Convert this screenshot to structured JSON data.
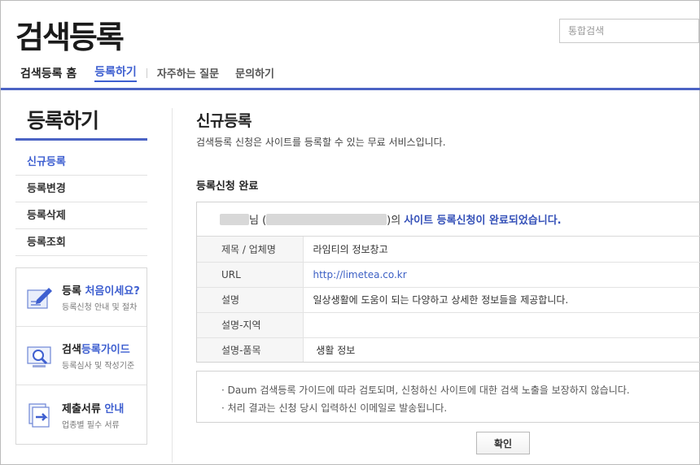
{
  "header": {
    "logo": "검색등록",
    "search_placeholder": "통합검색"
  },
  "nav": {
    "home": "검색등록 홈",
    "active": "등록하기",
    "faq": "자주하는 질문",
    "contact": "문의하기"
  },
  "sidebar": {
    "title": "등록하기",
    "items": [
      {
        "label": "신규등록"
      },
      {
        "label": "등록변경"
      },
      {
        "label": "등록삭제"
      },
      {
        "label": "등록조회"
      }
    ],
    "guides": [
      {
        "title_a": "등록 ",
        "title_b": "처음이세요?",
        "sub": "등록신청 안내 및 절차",
        "icon": "pencil-note-icon"
      },
      {
        "title_a": "검색",
        "title_b": "등록가이드",
        "sub": "등록심사 및 작성기준",
        "icon": "magnifier-screen-icon"
      },
      {
        "title_a": "제출서류 ",
        "title_b": "안내",
        "sub": "업종별 필수 서류",
        "icon": "documents-arrow-icon"
      }
    ]
  },
  "main": {
    "title": "신규등록",
    "description": "검색등록 신청은 사이트를 등록할 수 있는 무료 서비스입니다.",
    "section_title": "등록신청 완료",
    "result": {
      "suffix_nim": "님 (",
      "suffix_close": ")의",
      "complete_msg": "사이트 등록신청이 완료되었습니다.",
      "rows": [
        {
          "label": "제목 / 업체명",
          "value": "라임티의 정보창고"
        },
        {
          "label": "URL",
          "value": "http://limetea.co.kr"
        },
        {
          "label": "설명",
          "value": "일상생활에 도움이 되는 다양하고 상세한 정보들을 제공합니다."
        },
        {
          "label": "설명-지역",
          "value": ""
        },
        {
          "label": "설명-품목",
          "value": " 생활 정보"
        }
      ]
    },
    "notice": [
      "· Daum 검색등록 가이드에 따라 검토되며, 신청하신 사이트에 대한 검색 노출을 보장하지 않습니다.",
      "· 처리 결과는 신청 당시 입력하신 이메일로 발송됩니다."
    ],
    "confirm_label": "확인"
  },
  "colors": {
    "accent": "#3e5fd0",
    "rule": "#4b63c4"
  }
}
